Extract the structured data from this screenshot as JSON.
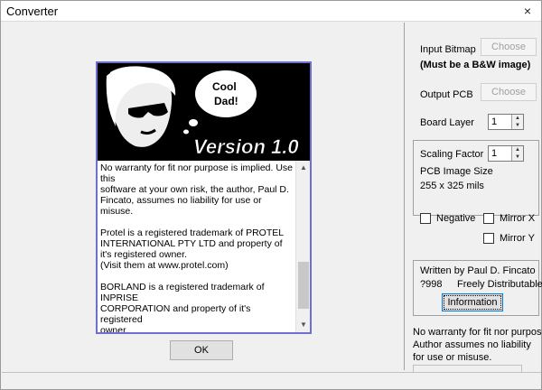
{
  "window": {
    "title": "Converter",
    "close_glyph": "×"
  },
  "about": {
    "banner_bubble_line1": "Cool",
    "banner_bubble_line2": "Dad!",
    "banner_version": "Version 1.0",
    "body_text": "No warranty for fit nor purpose is implied. Use this\nsoftware at your own risk, the author, Paul D.\nFincato, assumes no liability for use or misuse.\n\nProtel is a registered trademark of PROTEL\nINTERNATIONAL PTY LTD and property of\nit's registered owner.\n(Visit them at www.protel.com)\n\nBORLAND is a registered trademark of\nINPRISE\nCORPORATION and property of it's registered\nowner.\n(Visit them at www.borland.com)  Absolutely",
    "ok_label": "OK"
  },
  "panel": {
    "input_bitmap_label": "Input Bitmap",
    "input_choose_label": "Choose",
    "bitmap_note": "(Must be a B&W image)",
    "output_pcb_label": "Output PCB",
    "output_choose_label": "Choose",
    "board_layer_label": "Board Layer",
    "board_layer_value": "1",
    "scaling_factor_label": "Scaling Factor",
    "scaling_factor_value": "1",
    "pcb_image_size_label": "PCB Image Size",
    "pcb_image_size_value": "255 x 325 mils",
    "negative_label": "Negative",
    "mirror_x_label": "Mirror X",
    "mirror_y_label": "Mirror Y",
    "written_by": "Written by Paul D. Fincato",
    "year": "?998",
    "freely": "Freely Distributable",
    "information_label": "Information",
    "bottom_note_1": "No warranty for fit nor purpose",
    "bottom_note_2": "Author assumes no liability",
    "bottom_note_3": "for use or misuse."
  }
}
